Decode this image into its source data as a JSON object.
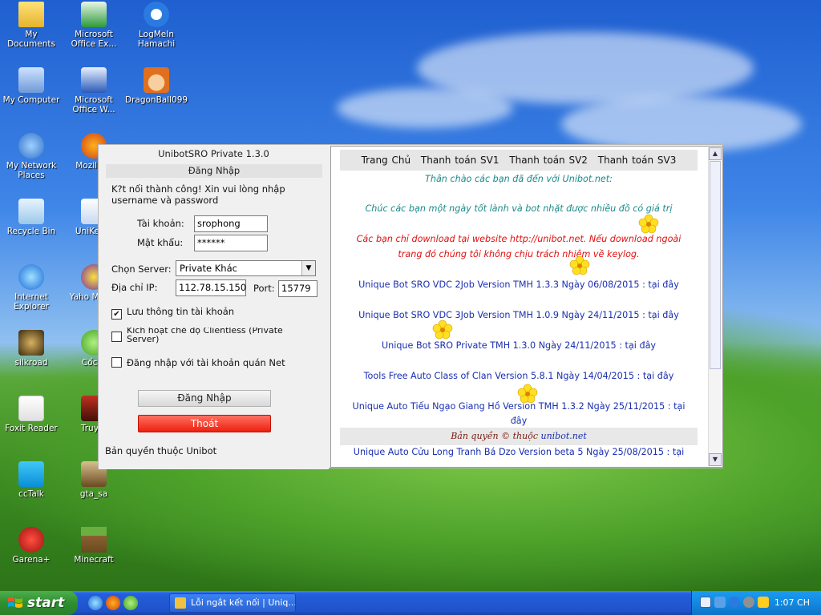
{
  "desktop": {
    "icons": [
      {
        "label": "My Documents",
        "icon": "folder-documents-icon"
      },
      {
        "label": "Microsoft Office Ex...",
        "icon": "excel-icon"
      },
      {
        "label": "LogMeIn Hamachi",
        "icon": "hamachi-icon"
      },
      {
        "label": "My Computer",
        "icon": "computer-icon"
      },
      {
        "label": "Microsoft Office W...",
        "icon": "word-icon"
      },
      {
        "label": "DragonBall099",
        "icon": "dragonball-icon"
      },
      {
        "label": "My Network Places",
        "icon": "network-icon"
      },
      {
        "label": "Mozilla F",
        "icon": "firefox-icon"
      },
      {
        "label": "Recycle Bin",
        "icon": "recycle-bin-icon"
      },
      {
        "label": "UniKeyVi",
        "icon": "unikey-icon"
      },
      {
        "label": "Internet Explorer",
        "icon": "ie-icon"
      },
      {
        "label": "Yaho Messe",
        "icon": "yahoo-icon"
      },
      {
        "label": "silkroad",
        "icon": "silkroad-icon"
      },
      {
        "label": "Cốc C",
        "icon": "coccoc-icon"
      },
      {
        "label": "Foxit Reader",
        "icon": "foxit-icon"
      },
      {
        "label": "Truy K",
        "icon": "truyky-icon"
      },
      {
        "label": "ccTalk",
        "icon": "cctalk-icon"
      },
      {
        "label": "gta_sa",
        "icon": "gta-icon"
      },
      {
        "label": "Garena+",
        "icon": "garena-icon"
      },
      {
        "label": "Minecraft",
        "icon": "minecraft-icon"
      }
    ]
  },
  "login": {
    "title": "UnibotSRO Private 1.3.0",
    "header": "Đăng Nhập",
    "status_message": "K?t nối thành công! Xin vui lòng nhập username và password",
    "username_label": "Tài khoản:",
    "username_value": "srophong",
    "password_label": "Mật khẩu:",
    "password_value": "******",
    "server_label": "Chọn Server:",
    "server_value": "Private Khác",
    "ip_label": "Địa chỉ IP:",
    "ip_value": "112.78.15.150",
    "port_label": "Port:",
    "port_value": "15779",
    "save_info_label": "Lưu thông tin tài khoản",
    "clientless_label": "Kích hoạt chế độ Clientless (Private Server)",
    "netcafe_label": "Đăng nhập với tài khoản quán Net",
    "login_button": "Đăng Nhập",
    "exit_button": "Thoát",
    "copyright": "Bản quyền thuộc Unibot",
    "exit_color": "#f03020"
  },
  "web": {
    "nav": [
      "Trang Chủ",
      "Thanh toán SV1",
      "Thanh toán SV2",
      "Thanh toán SV3"
    ],
    "welcome": "Thân chào các bạn đã đến với Unibot.net:",
    "wish": "Chúc các bạn một ngày tốt lành và bot nhặt được nhiều đồ có giá trị",
    "warning_1": "Các bạn chỉ download tại website http://unibot.net. Nếu download ngoài",
    "warning_2": "trang đó chúng tôi không chịu trách nhiệm về keylog.",
    "links": [
      "Unique Bot SRO VDC 2Job Version TMH 1.3.3 Ngày 06/08/2015 : tại đây",
      "Unique Bot SRO VDC 3Job Version TMH 1.0.9 Ngày 24/11/2015 : tại đây",
      "Unique Bot SRO Private TMH 1.3.0 Ngày 24/11/2015 : tại đây",
      "Tools Free Auto Class of Clan Version 5.8.1 Ngày 14/04/2015 : tại đây",
      "Unique Auto Tiếu Ngạo Giang Hồ Version TMH 1.3.2 Ngày 25/11/2015 : tại",
      "đây",
      "Unique Auto Cửu Long Tranh Bá Dzo Version beta 5 Ngày 25/08/2015 : tại"
    ],
    "footer_prefix": "Bản quyền © thuộc",
    "footer_site": "unibot.net"
  },
  "taskbar": {
    "start_label": "start",
    "task_label": "Lỗi ngắt kết nối | Uniq...",
    "clock": "1:07 CH"
  }
}
